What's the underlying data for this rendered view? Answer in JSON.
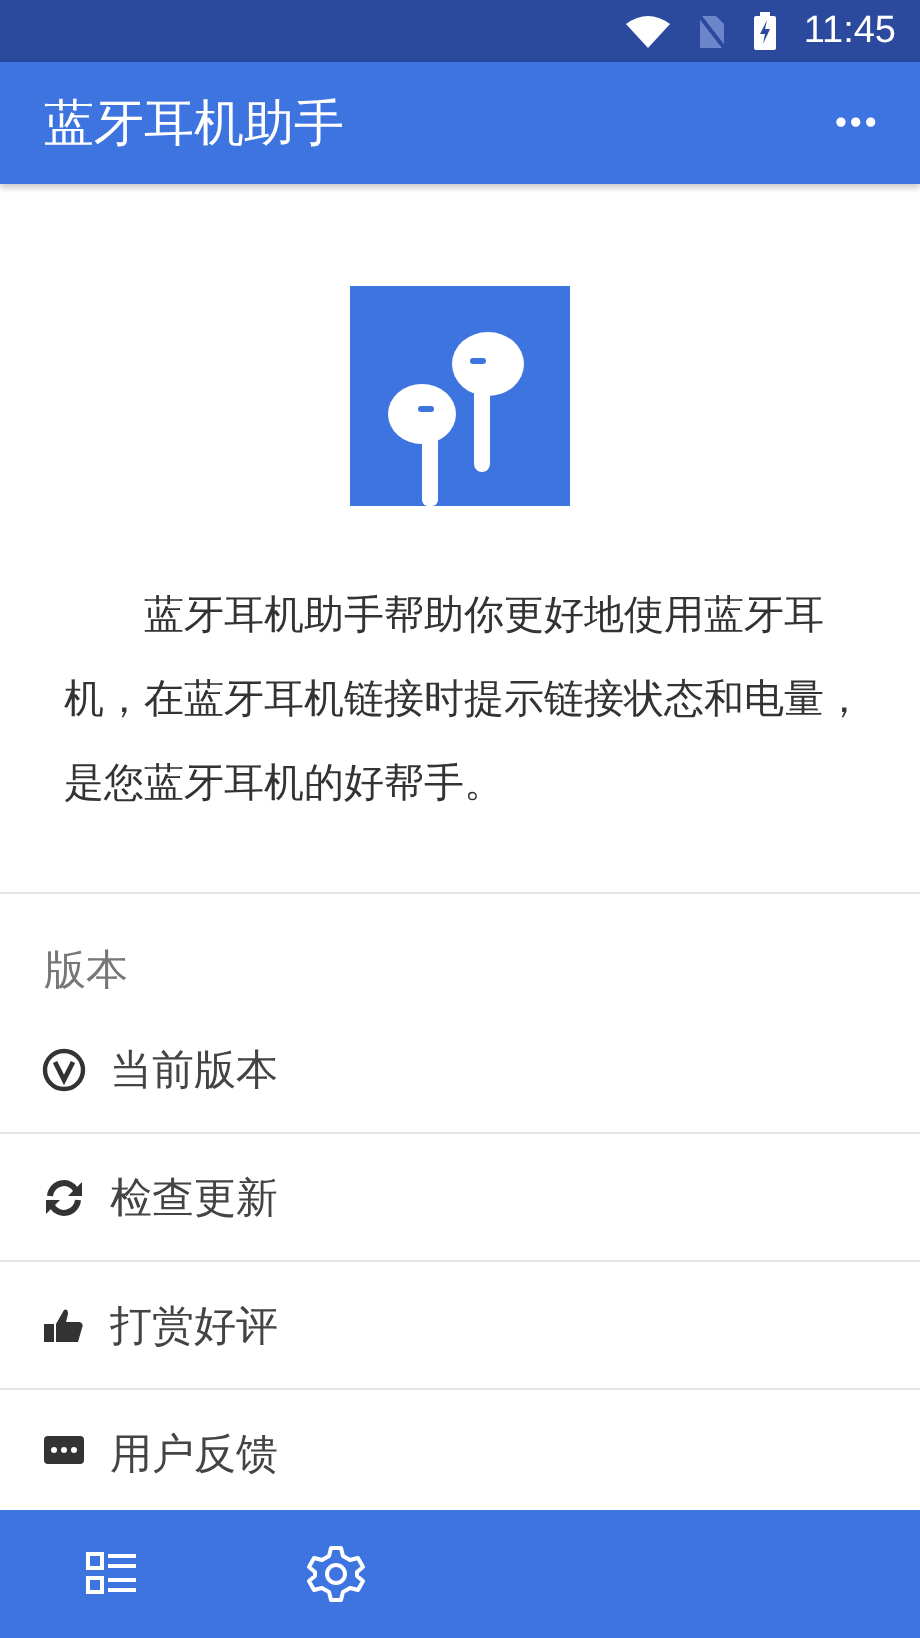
{
  "status_bar": {
    "time": "11:45"
  },
  "app_bar": {
    "title": "蓝牙耳机助手",
    "menu": "•••"
  },
  "intro": {
    "text": "蓝牙耳机助手帮助你更好地使用蓝牙耳机，在蓝牙耳机链接时提示链接状态和电量，是您蓝牙耳机的好帮手。"
  },
  "section": {
    "title": "版本"
  },
  "items": [
    {
      "kind": "version",
      "label": "当前版本"
    },
    {
      "kind": "update",
      "label": "检查更新"
    },
    {
      "kind": "like",
      "label": "打赏好评"
    },
    {
      "kind": "feedback",
      "label": "用户反馈"
    }
  ],
  "bottom_nav": [
    {
      "kind": "list"
    },
    {
      "kind": "settings"
    }
  ]
}
